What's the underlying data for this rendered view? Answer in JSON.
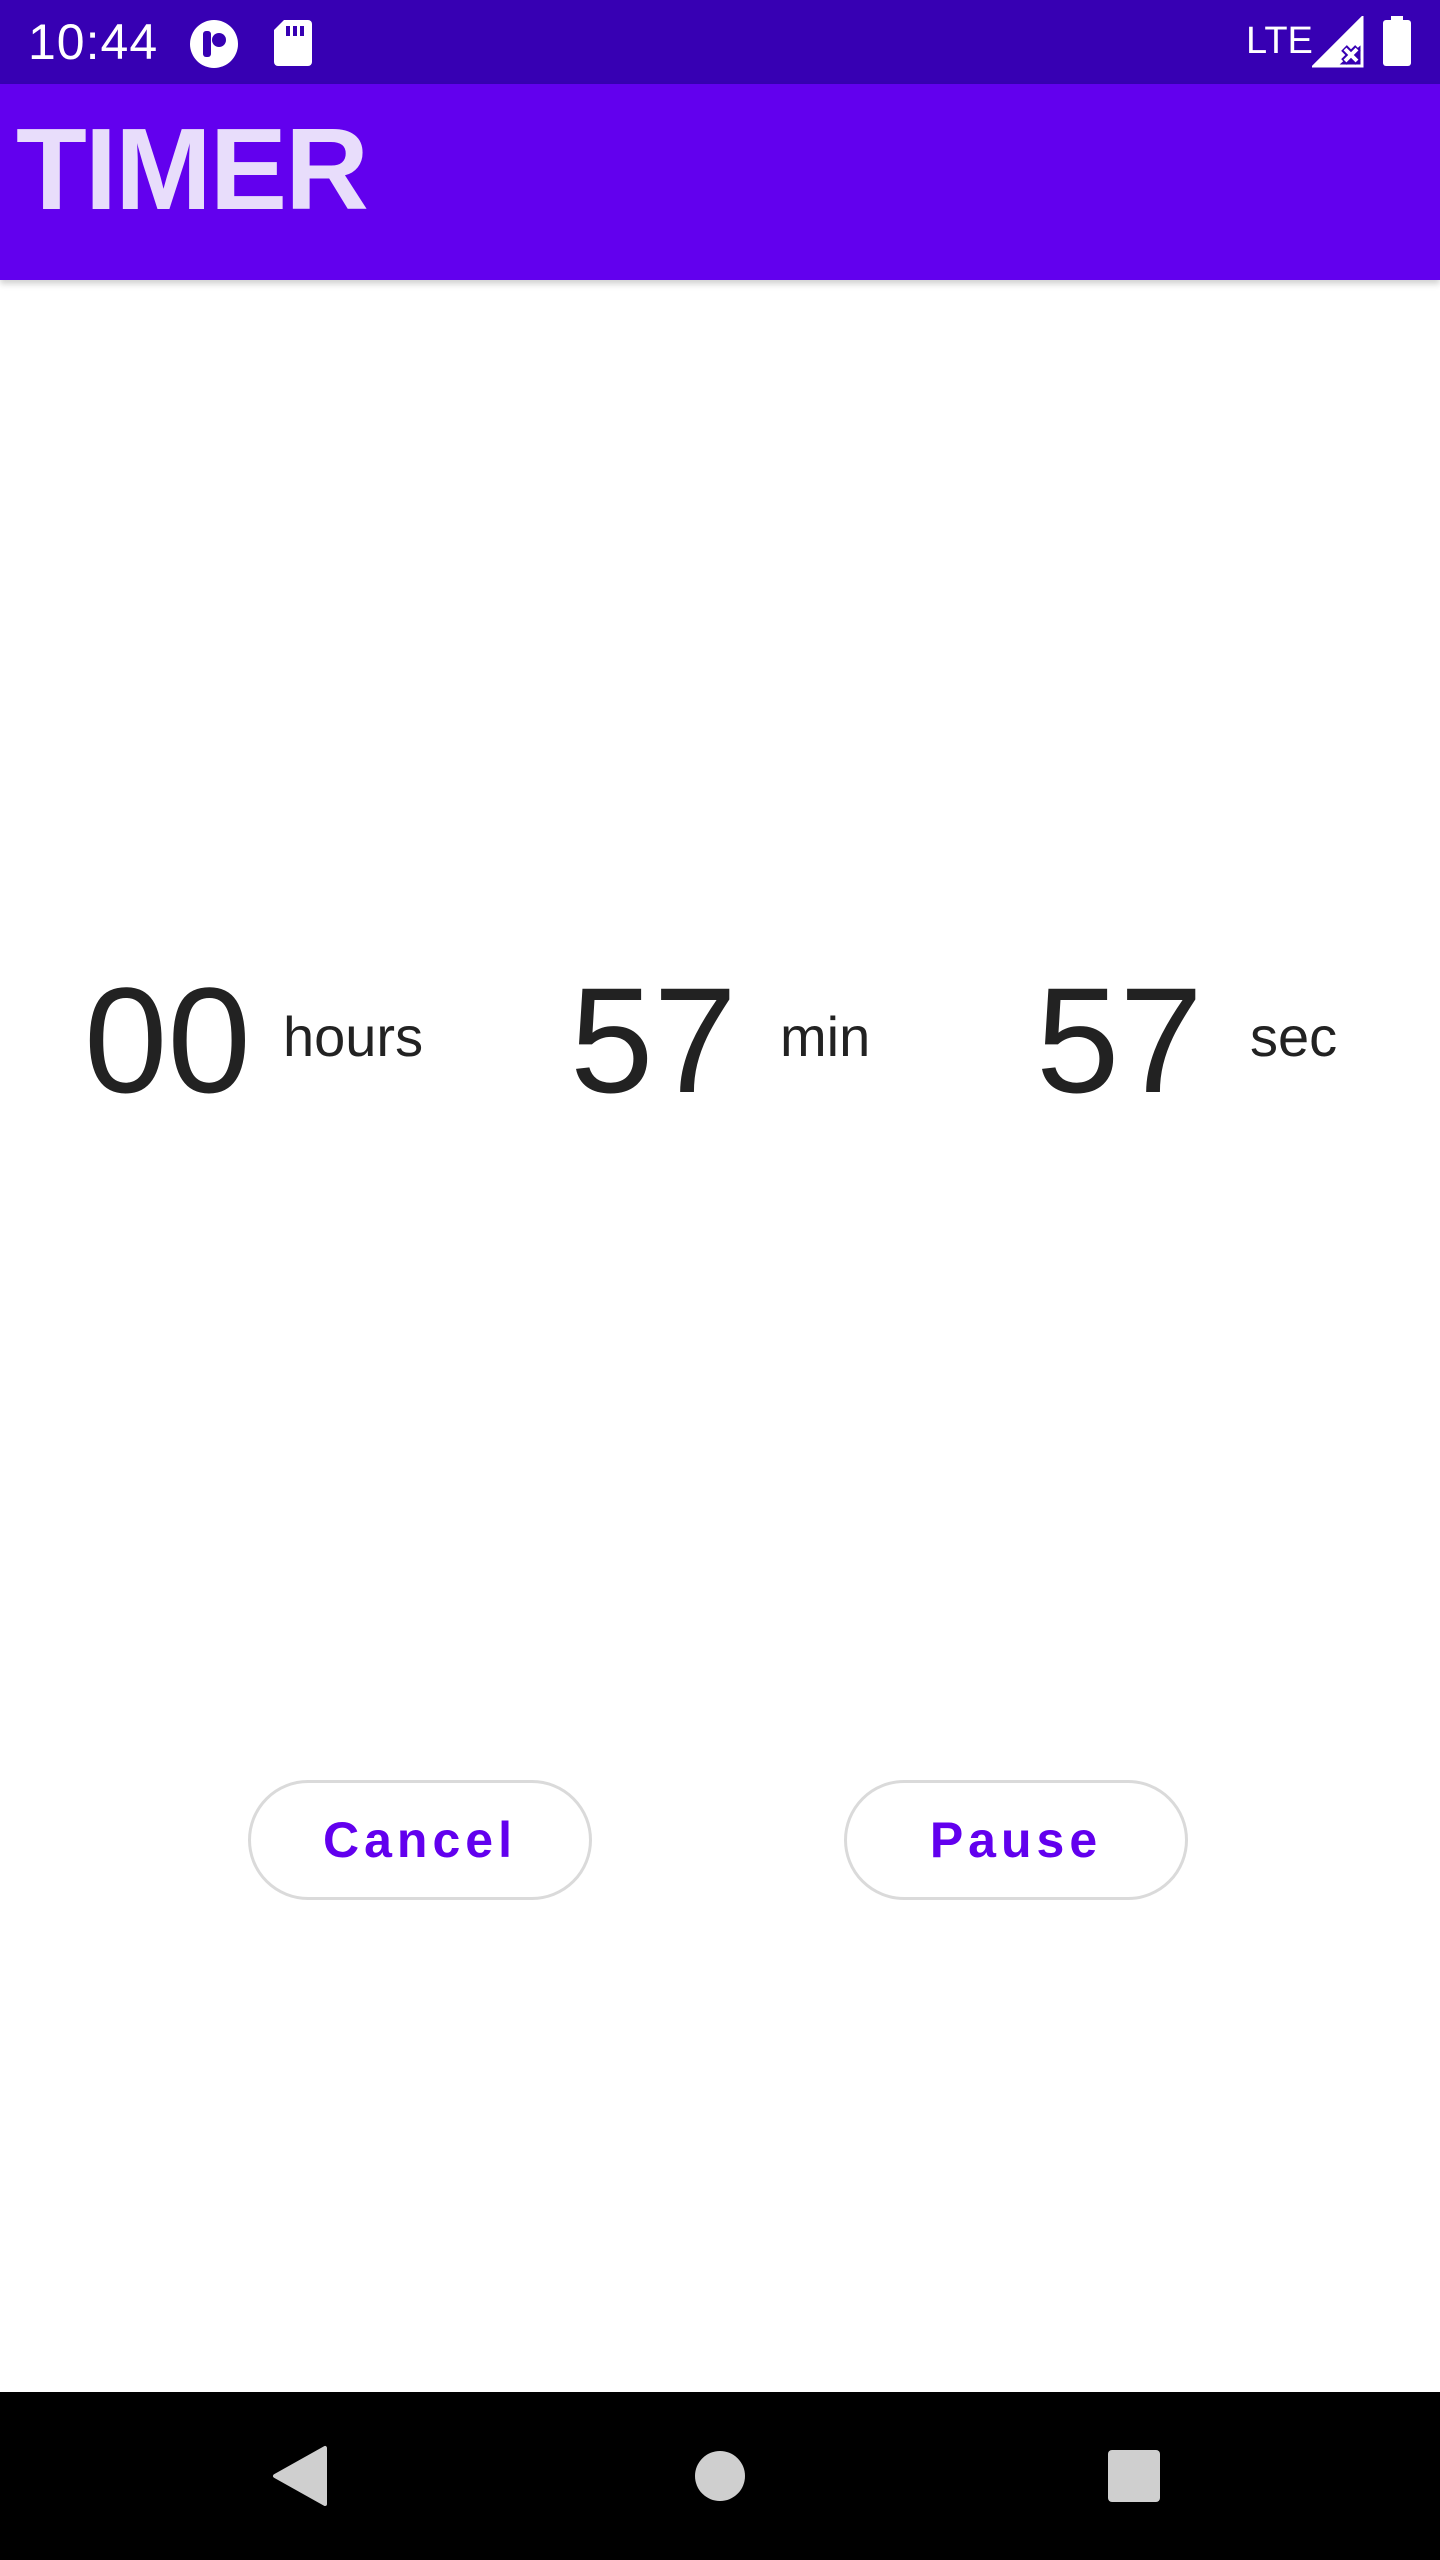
{
  "status_bar": {
    "time": "10:44",
    "network": "LTE",
    "icons": [
      "app-notification-icon",
      "sd-card-icon",
      "signal-no-data-icon",
      "battery-icon"
    ]
  },
  "app_bar": {
    "title": "TIMER"
  },
  "timer": {
    "hours": "00",
    "hours_label": "hours",
    "minutes": "57",
    "minutes_label": "min",
    "seconds": "57",
    "seconds_label": "sec"
  },
  "actions": {
    "cancel_label": "Cancel",
    "pause_label": "Pause"
  },
  "nav_bar": {
    "icons": [
      "back-icon",
      "home-icon",
      "recents-icon"
    ]
  },
  "colors": {
    "status_bar": "#3700B3",
    "app_bar": "#6200EE",
    "title_text": "#E8DDFB",
    "accent": "#6200EE",
    "timer_text": "#222222"
  }
}
